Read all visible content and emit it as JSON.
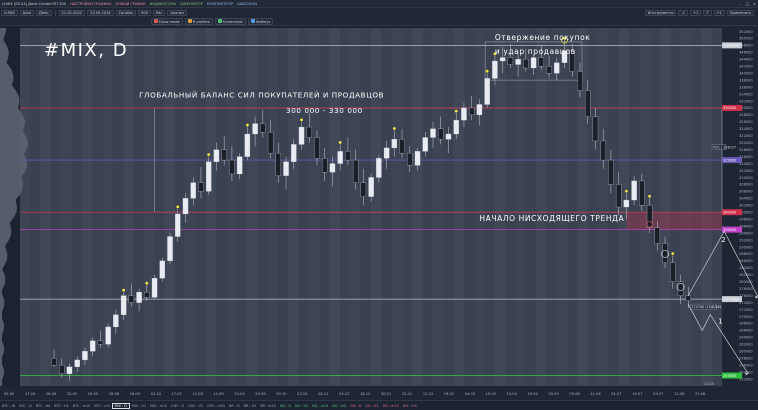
{
  "menubar": {
    "items": [
      {
        "label": "rt.MIX [09-24] День Candle RTI 200",
        "style": ""
      },
      {
        "label": "НАСТРОЙКИ ГРАФИКА",
        "style": "hl"
      },
      {
        "label": "НОВЫЙ ГРАФИК",
        "style": "hl"
      },
      {
        "label": "ИНДИКАТОРЫ",
        "style": "gr"
      },
      {
        "label": "СИМУЛЯТОР",
        "style": "gr"
      },
      {
        "label": "КОМПИЛЯТОР",
        "style": "bl"
      },
      {
        "label": "ШАБЛОНЫ",
        "style": "bl"
      }
    ]
  },
  "toolbar1": {
    "symbol": "rt.MIX",
    "mode": "Auto",
    "period": "День",
    "date_from": "21.02.2022",
    "date_to": "23.09.2024",
    "style": "Candles",
    "count": "500",
    "flag1": "Рис",
    "flag2": "Анализ",
    "right_tools": "Инструменты",
    "right_values": [
      "-1",
      "+1",
      "T",
      "+1"
    ],
    "apply": "Применить"
  },
  "toolbar2": {
    "items": [
      {
        "label": "Draw mode",
        "color": "#e05a5a"
      },
      {
        "label": "R profiles",
        "color": "#e0a040"
      },
      {
        "label": "Screenshot",
        "color": "#52c47a"
      },
      {
        "label": "Hotkeys",
        "color": "#5a9ae0"
      }
    ]
  },
  "chart_data": {
    "type": "candlestick",
    "title": "#MIX, D",
    "ylim": [
      250000,
      353000
    ],
    "y_ticks": [
      252000,
      254000,
      256000,
      258000,
      260000,
      262000,
      264000,
      266000,
      268000,
      270000,
      272000,
      274000,
      276000,
      278000,
      280000,
      282000,
      284000,
      286000,
      288000,
      290000,
      292000,
      294000,
      296000,
      298000,
      300000,
      302000,
      304000,
      306000,
      308000,
      310000,
      312000,
      314000,
      316000,
      318000,
      320000,
      322000,
      324000,
      326000,
      328000,
      330000,
      332000,
      334000,
      336000,
      338000,
      340000,
      342000,
      344000,
      346000,
      348000,
      350000,
      352000
    ],
    "x_ticks": [
      "05.05",
      "17.04",
      "26.06",
      "22.05",
      "15.05",
      "28.08",
      "16.09",
      "03.10",
      "17.01",
      "15.08",
      "11.09",
      "25.05",
      "25.09",
      "09.10",
      "23.10",
      "28.11",
      "04.12",
      "18.12",
      "30.01",
      "22.01",
      "12.03",
      "19.02",
      "04.03",
      "15.03",
      "15.04",
      "29.04",
      "20.05",
      "03.06",
      "11.06",
      "01.07",
      "15.07",
      "29.07",
      "12.08",
      "22.08"
    ],
    "price_levels": [
      {
        "value": 348000,
        "color": "#c8ccd4",
        "label": "1:348000"
      },
      {
        "value": 330000,
        "color": "#d0304a",
        "label": "330000"
      },
      {
        "value": 315000,
        "color": "#6a5ab8",
        "label": "315000"
      },
      {
        "value": 300000,
        "color": "#d0304a",
        "label": "300000"
      },
      {
        "value": 295000,
        "color": "#c040c8",
        "label": "295000"
      },
      {
        "value": 275000,
        "color": "#c8ccd4",
        "label": "1:275000"
      },
      {
        "value": 253000,
        "color": "#30c040",
        "label": "253000"
      }
    ],
    "current_price_label": "PDC | 318727",
    "current_price": 318700,
    "annotations": [
      {
        "text": "Отвержение покупок",
        "date_index": 70,
        "value": 349500
      },
      {
        "text": "и удар продавцов",
        "date_index": 70,
        "value": 345500
      },
      {
        "text": "ГЛОБАЛЬНЫЙ БАЛАНС СИЛ ПОКУПАТЕЛЕЙ И ПРОДАВЦОВ",
        "date_index": 23,
        "value": 333000
      },
      {
        "text": "300 000 - 330 000",
        "date_index": 40,
        "value": 328500
      },
      {
        "text": "НАЧАЛО НИСХОДЯЩЕГО ТРЕНДА",
        "date_index": 70,
        "value": 297500
      }
    ],
    "scenario_labels": [
      "1",
      "2"
    ],
    "info_tag": "272700 (15/8/24)",
    "last_label": "22.08",
    "candles": [
      {
        "o": 258000,
        "h": 260500,
        "l": 255500,
        "c": 256000
      },
      {
        "o": 256000,
        "h": 258000,
        "l": 252500,
        "c": 253500
      },
      {
        "o": 253500,
        "h": 256500,
        "l": 251500,
        "c": 255500
      },
      {
        "o": 255500,
        "h": 258500,
        "l": 254000,
        "c": 257500
      },
      {
        "o": 257500,
        "h": 261000,
        "l": 256000,
        "c": 260000
      },
      {
        "o": 260000,
        "h": 264000,
        "l": 258500,
        "c": 263000
      },
      {
        "o": 263000,
        "h": 266000,
        "l": 261000,
        "c": 262000
      },
      {
        "o": 262000,
        "h": 268000,
        "l": 261000,
        "c": 267000
      },
      {
        "o": 267000,
        "h": 272000,
        "l": 265000,
        "c": 270500
      },
      {
        "o": 270500,
        "h": 277000,
        "l": 269000,
        "c": 276000
      },
      {
        "o": 276000,
        "h": 279500,
        "l": 273000,
        "c": 274000
      },
      {
        "o": 274000,
        "h": 278000,
        "l": 271500,
        "c": 277000
      },
      {
        "o": 277000,
        "h": 279000,
        "l": 274500,
        "c": 275500
      },
      {
        "o": 275500,
        "h": 282000,
        "l": 275000,
        "c": 281000
      },
      {
        "o": 281000,
        "h": 287000,
        "l": 280000,
        "c": 286000
      },
      {
        "o": 286000,
        "h": 294000,
        "l": 285000,
        "c": 293000
      },
      {
        "o": 293000,
        "h": 301000,
        "l": 291500,
        "c": 299500
      },
      {
        "o": 299500,
        "h": 305500,
        "l": 297000,
        "c": 304000
      },
      {
        "o": 304000,
        "h": 310000,
        "l": 302000,
        "c": 308500
      },
      {
        "o": 308500,
        "h": 313000,
        "l": 304000,
        "c": 306000
      },
      {
        "o": 306000,
        "h": 316000,
        "l": 305000,
        "c": 314500
      },
      {
        "o": 314500,
        "h": 320000,
        "l": 312000,
        "c": 318000
      },
      {
        "o": 318000,
        "h": 322000,
        "l": 313500,
        "c": 315000
      },
      {
        "o": 315000,
        "h": 319000,
        "l": 309000,
        "c": 311000
      },
      {
        "o": 311000,
        "h": 317000,
        "l": 309500,
        "c": 316000
      },
      {
        "o": 316000,
        "h": 324500,
        "l": 315000,
        "c": 322500
      },
      {
        "o": 322500,
        "h": 327500,
        "l": 319000,
        "c": 325500
      },
      {
        "o": 325500,
        "h": 329500,
        "l": 321500,
        "c": 323000
      },
      {
        "o": 323000,
        "h": 326500,
        "l": 315500,
        "c": 317000
      },
      {
        "o": 317000,
        "h": 320000,
        "l": 308500,
        "c": 310500
      },
      {
        "o": 310500,
        "h": 316000,
        "l": 306500,
        "c": 314500
      },
      {
        "o": 314500,
        "h": 321000,
        "l": 312500,
        "c": 319500
      },
      {
        "o": 319500,
        "h": 326000,
        "l": 318000,
        "c": 324500
      },
      {
        "o": 324500,
        "h": 328500,
        "l": 320000,
        "c": 321500
      },
      {
        "o": 321500,
        "h": 323500,
        "l": 313500,
        "c": 315500
      },
      {
        "o": 315500,
        "h": 318500,
        "l": 309000,
        "c": 311500
      },
      {
        "o": 311500,
        "h": 316000,
        "l": 307500,
        "c": 314000
      },
      {
        "o": 314000,
        "h": 319500,
        "l": 312000,
        "c": 317500
      },
      {
        "o": 317500,
        "h": 321500,
        "l": 313500,
        "c": 315000
      },
      {
        "o": 315000,
        "h": 318000,
        "l": 306500,
        "c": 308500
      },
      {
        "o": 308500,
        "h": 312500,
        "l": 302000,
        "c": 304500
      },
      {
        "o": 304500,
        "h": 311000,
        "l": 303000,
        "c": 310000
      },
      {
        "o": 310000,
        "h": 316500,
        "l": 308500,
        "c": 315500
      },
      {
        "o": 315500,
        "h": 320500,
        "l": 312500,
        "c": 318500
      },
      {
        "o": 318500,
        "h": 323500,
        "l": 316000,
        "c": 321000
      },
      {
        "o": 321000,
        "h": 324000,
        "l": 315500,
        "c": 317000
      },
      {
        "o": 317000,
        "h": 319000,
        "l": 311500,
        "c": 313500
      },
      {
        "o": 313500,
        "h": 318500,
        "l": 312000,
        "c": 317500
      },
      {
        "o": 317500,
        "h": 323000,
        "l": 316000,
        "c": 321500
      },
      {
        "o": 321500,
        "h": 326000,
        "l": 318500,
        "c": 324000
      },
      {
        "o": 324000,
        "h": 327500,
        "l": 319500,
        "c": 321000
      },
      {
        "o": 321000,
        "h": 324500,
        "l": 317000,
        "c": 322500
      },
      {
        "o": 322500,
        "h": 328500,
        "l": 321000,
        "c": 326500
      },
      {
        "o": 326500,
        "h": 331500,
        "l": 324500,
        "c": 330000
      },
      {
        "o": 330000,
        "h": 333500,
        "l": 326500,
        "c": 328000
      },
      {
        "o": 328000,
        "h": 332500,
        "l": 325000,
        "c": 331000
      },
      {
        "o": 331000,
        "h": 340000,
        "l": 330000,
        "c": 338500
      },
      {
        "o": 338500,
        "h": 345000,
        "l": 336500,
        "c": 343500
      },
      {
        "o": 343500,
        "h": 347500,
        "l": 340000,
        "c": 344500
      },
      {
        "o": 344500,
        "h": 348500,
        "l": 341500,
        "c": 342500
      },
      {
        "o": 342500,
        "h": 346000,
        "l": 339000,
        "c": 344000
      },
      {
        "o": 344000,
        "h": 347000,
        "l": 340500,
        "c": 341500
      },
      {
        "o": 341500,
        "h": 345500,
        "l": 339500,
        "c": 344500
      },
      {
        "o": 344500,
        "h": 348000,
        "l": 341000,
        "c": 342000
      },
      {
        "o": 342000,
        "h": 345000,
        "l": 338500,
        "c": 340000
      },
      {
        "o": 340000,
        "h": 344500,
        "l": 338000,
        "c": 343000
      },
      {
        "o": 343000,
        "h": 349500,
        "l": 341500,
        "c": 346500
      },
      {
        "o": 346500,
        "h": 348500,
        "l": 339000,
        "c": 340500
      },
      {
        "o": 340500,
        "h": 343000,
        "l": 333000,
        "c": 335000
      },
      {
        "o": 335000,
        "h": 338000,
        "l": 325500,
        "c": 327500
      },
      {
        "o": 327500,
        "h": 330000,
        "l": 318000,
        "c": 320500
      },
      {
        "o": 320500,
        "h": 324000,
        "l": 312500,
        "c": 315000
      },
      {
        "o": 315000,
        "h": 318000,
        "l": 305500,
        "c": 308000
      },
      {
        "o": 308000,
        "h": 311500,
        "l": 299000,
        "c": 301500
      },
      {
        "o": 301500,
        "h": 305500,
        "l": 298000,
        "c": 303500
      },
      {
        "o": 303500,
        "h": 310500,
        "l": 302000,
        "c": 309000
      },
      {
        "o": 309000,
        "h": 311000,
        "l": 300500,
        "c": 302000
      },
      {
        "o": 302000,
        "h": 304000,
        "l": 294000,
        "c": 295500
      },
      {
        "o": 295500,
        "h": 297500,
        "l": 289000,
        "c": 291000
      },
      {
        "o": 291000,
        "h": 293000,
        "l": 284000,
        "c": 285500
      },
      {
        "o": 285500,
        "h": 287500,
        "l": 278000,
        "c": 280000
      },
      {
        "o": 280000,
        "h": 282000,
        "l": 273500,
        "c": 276000
      },
      {
        "o": 276000,
        "h": 278500,
        "l": 272500,
        "c": 274500
      }
    ]
  },
  "bottombar": {
    "tabs": [
      {
        "label": "BTC : W",
        "style": ""
      },
      {
        "label": "BTC : D",
        "style": ""
      },
      {
        "label": "BTC : H4",
        "style": ""
      },
      {
        "label": "BTC : H1",
        "style": ""
      },
      {
        "label": "BTC : m15",
        "style": ""
      },
      {
        "label": "BTC : m5",
        "style": ""
      },
      {
        "label": "MIX : D",
        "style": "act"
      },
      {
        "label": "MIX : H1",
        "style": ""
      },
      {
        "label": "MIX : m15",
        "style": ""
      },
      {
        "label": "CNY : D",
        "style": ""
      },
      {
        "label": "CNY : H1",
        "style": ""
      },
      {
        "label": "CNY : m15",
        "style": ""
      },
      {
        "label": "BR : D",
        "style": ""
      },
      {
        "label": "BR : H1",
        "style": ""
      },
      {
        "label": "BR : m15",
        "style": ""
      },
      {
        "label": "NG : D",
        "style": "green"
      },
      {
        "label": "NG : H1",
        "style": "green"
      },
      {
        "label": "NG : m15",
        "style": "green"
      },
      {
        "label": "NG : m5",
        "style": "green"
      },
      {
        "label": "GD : D",
        "style": "pink"
      },
      {
        "label": "GD : H1",
        "style": "pink"
      },
      {
        "label": "GD : m15",
        "style": "pink"
      },
      {
        "label": "GD : m5",
        "style": "pink"
      }
    ]
  }
}
